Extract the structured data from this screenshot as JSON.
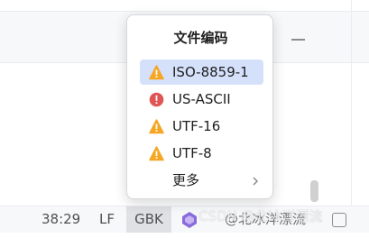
{
  "popup": {
    "title": "文件编码",
    "items": [
      {
        "label": "ISO-8859-1",
        "icon": "warning-icon",
        "selected": true
      },
      {
        "label": "US-ASCII",
        "icon": "error-icon",
        "selected": false
      },
      {
        "label": "UTF-16",
        "icon": "warning-icon",
        "selected": false
      },
      {
        "label": "UTF-8",
        "icon": "warning-icon",
        "selected": false
      },
      {
        "label": "更多",
        "icon": "",
        "selected": false,
        "submenu_icon": "chevron-right-icon"
      }
    ]
  },
  "statusbar": {
    "cursor_position": "38:29",
    "line_separator": "LF",
    "encoding": "GBK",
    "extra_text": "@北冰洋漂流"
  },
  "watermark": "CSDN @北冰洋漂流",
  "colors": {
    "warning": "#f5a623",
    "error": "#e05555",
    "selected_bg": "#d5e1fb",
    "statusbar_bg": "#f7f8fa"
  }
}
